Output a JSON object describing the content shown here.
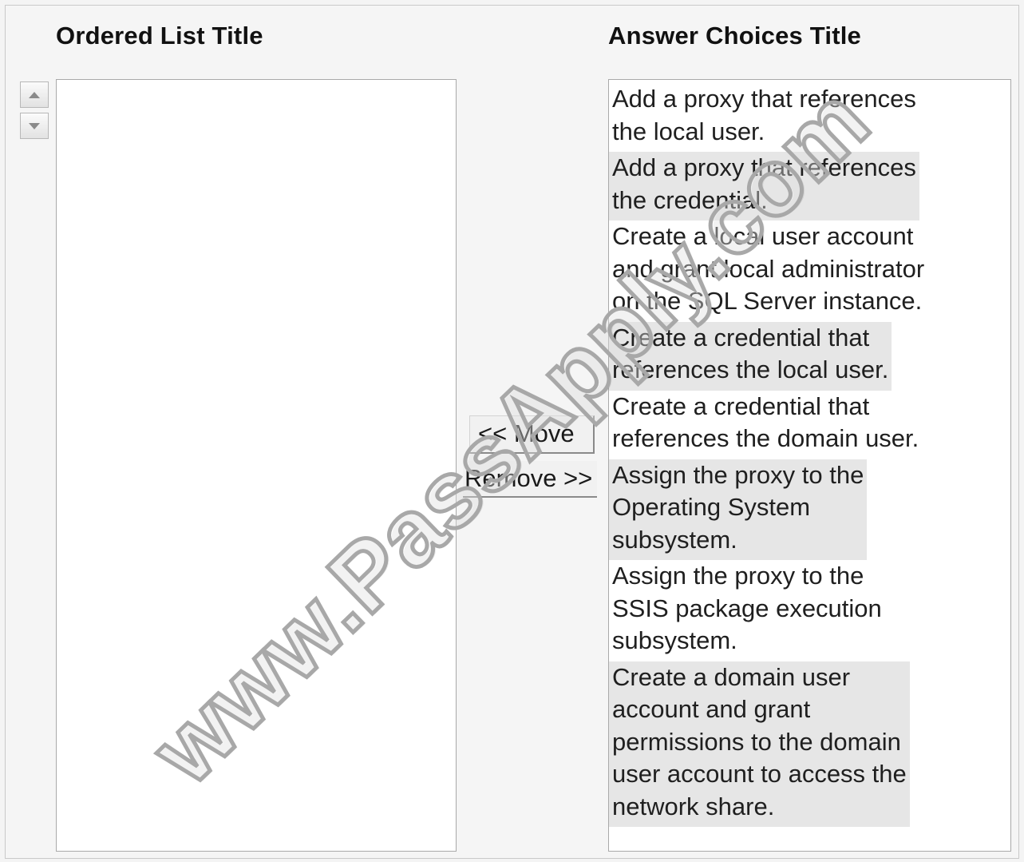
{
  "ordered_list": {
    "title": "Ordered List Title",
    "items": []
  },
  "answer_choices": {
    "title": "Answer Choices Title",
    "items": [
      {
        "lines": [
          "Add a proxy that references",
          "the local user."
        ],
        "shaded": false
      },
      {
        "lines": [
          "Add a proxy that references",
          "the credential."
        ],
        "shaded": true
      },
      {
        "lines": [
          "Create a local user account",
          "and grant local administrator",
          "on the SQL Server instance."
        ],
        "shaded": false
      },
      {
        "lines": [
          "Create a credential that",
          "references the local user."
        ],
        "shaded": true
      },
      {
        "lines": [
          "Create a credential that",
          "references the domain user."
        ],
        "shaded": false
      },
      {
        "lines": [
          "Assign the proxy to the",
          "Operating System",
          "subsystem."
        ],
        "shaded": true
      },
      {
        "lines": [
          "Assign the proxy to the",
          "SSIS package execution",
          "subsystem."
        ],
        "shaded": false
      },
      {
        "lines": [
          "Create a domain user",
          "account and grant",
          "permissions to the domain",
          "user account to access the",
          "network share."
        ],
        "shaded": true
      }
    ]
  },
  "buttons": {
    "move_label": "<< Move",
    "remove_label": "Remove >>",
    "move_up_icon": "up-arrow-icon",
    "move_down_icon": "down-arrow-icon"
  },
  "watermark": {
    "text": "www.PassApply.com"
  }
}
